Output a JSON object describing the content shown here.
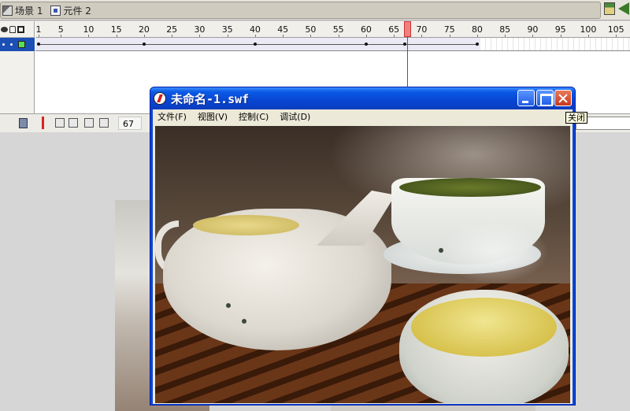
{
  "scene_bar": {
    "scene_label": "场景 1",
    "symbol_label": "元件 2",
    "icons": [
      "scene-icon",
      "symbol-icon",
      "edit-scene-icon",
      "edit-symbol-icon"
    ]
  },
  "timeline": {
    "ruler_ticks": [
      "1",
      "5",
      "10",
      "15",
      "20",
      "25",
      "30",
      "35",
      "40",
      "45",
      "50",
      "55",
      "60",
      "65",
      "70",
      "75",
      "80",
      "85",
      "90",
      "95",
      "100",
      "105"
    ],
    "current_frame": "67",
    "last_frame": 80,
    "keyframes": [
      1,
      20,
      40,
      60,
      67,
      80
    ]
  },
  "player_window": {
    "title": "未命名-1.swf",
    "menus": [
      "文件(F)",
      "视图(V)",
      "控制(C)",
      "调试(D)"
    ]
  },
  "tooltip": {
    "text": "关闭"
  },
  "colors": {
    "titlebar": "#0a46d6",
    "layer_selected": "#1c4fb5",
    "playhead": "#e02020"
  }
}
